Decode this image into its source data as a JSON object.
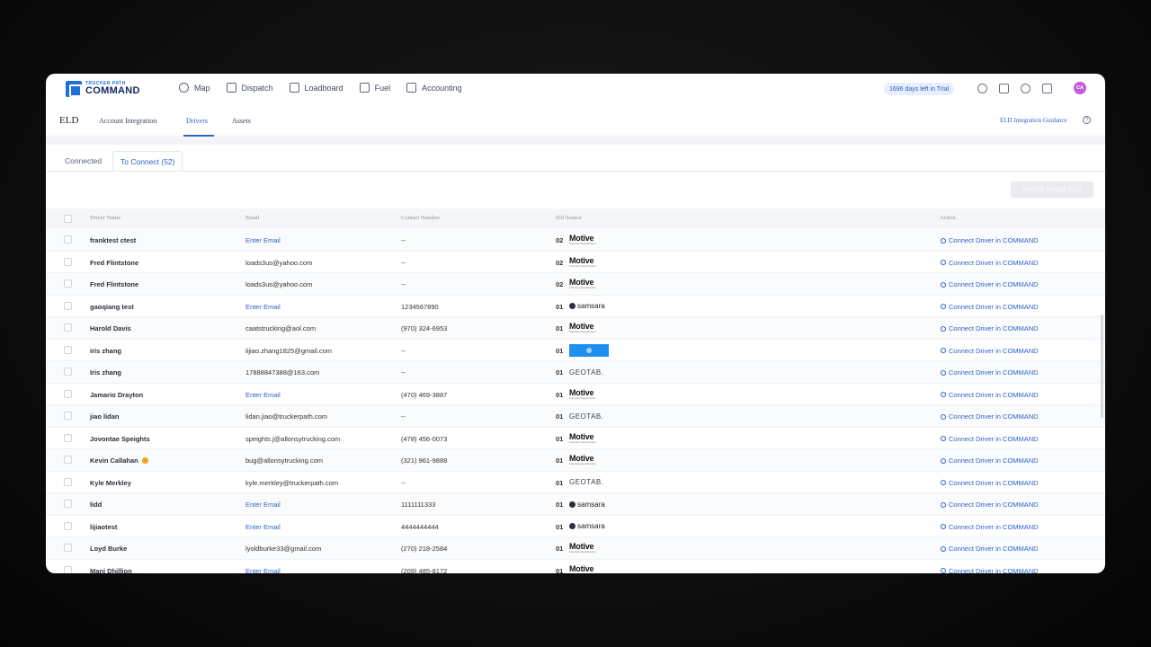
{
  "brand": {
    "small": "TRUCKER PATH",
    "name": "COMMAND"
  },
  "nav": [
    {
      "label": "Map",
      "icon": "globe-icon"
    },
    {
      "label": "Dispatch",
      "icon": "calendar-icon"
    },
    {
      "label": "Loadboard",
      "icon": "box-icon"
    },
    {
      "label": "Fuel",
      "icon": "fuel-icon"
    },
    {
      "label": "Accounting",
      "icon": "wallet-icon"
    }
  ],
  "trial": "1696 days left in Trial",
  "avatar": "CA",
  "subnav": {
    "title": "ELD",
    "tabs": [
      "Account Integration",
      "Drivers",
      "Assets"
    ],
    "active": "Drivers",
    "guidance": "ELD Integration Guidance"
  },
  "connect_tabs": [
    "Connected",
    "To Connect (52)"
  ],
  "invite_button": "INVITE FROM ELD",
  "columns": {
    "name": "Driver Name",
    "email": "Email",
    "phone": "Contact Number",
    "source": "Eld Source",
    "action": "Action"
  },
  "action_label": "Connect Driver in COMMAND",
  "rows": [
    {
      "name": "franktest ctest",
      "email": "Enter Email",
      "email_link": true,
      "phone": "--",
      "num": "02",
      "source": "motive"
    },
    {
      "name": "Fred Flintstone",
      "email": "loads3us@yahoo.com",
      "email_link": false,
      "phone": "--",
      "num": "02",
      "source": "motive"
    },
    {
      "name": "Fred Flintstone",
      "email": "loads3us@yahoo.com",
      "email_link": false,
      "phone": "--",
      "num": "02",
      "source": "motive"
    },
    {
      "name": "gaoqiang test",
      "email": "Enter Email",
      "email_link": true,
      "phone": "1234567890",
      "num": "01",
      "source": "samsara"
    },
    {
      "name": "Harold Davis",
      "email": "caatstrucking@aol.com",
      "email_link": false,
      "phone": "(970) 324-6953",
      "num": "01",
      "source": "motive"
    },
    {
      "name": "iris zhang",
      "email": "lijiao.zhang1825@gmail.com",
      "email_link": false,
      "phone": "--",
      "num": "01",
      "source": "blue"
    },
    {
      "name": "Iris zhang",
      "email": "17888847388@163.com",
      "email_link": false,
      "phone": "--",
      "num": "01",
      "source": "geotab"
    },
    {
      "name": "Jamario Drayton",
      "email": "Enter Email",
      "email_link": true,
      "phone": "(470) 469-3887",
      "num": "01",
      "source": "motive"
    },
    {
      "name": "jiao lidan",
      "email": "lidan.jiao@truckerpath.com",
      "email_link": false,
      "phone": "--",
      "num": "01",
      "source": "geotab"
    },
    {
      "name": "Jovontae Speights",
      "email": "speights.j@allonsytrucking.com",
      "email_link": false,
      "phone": "(478) 456-0073",
      "num": "01",
      "source": "motive"
    },
    {
      "name": "Kevin Callahan",
      "email": "bug@allonsytrucking.com",
      "email_link": false,
      "phone": "(321) 961-9888",
      "num": "01",
      "source": "motive",
      "warn": true
    },
    {
      "name": "Kyle Merkley",
      "email": "kyle.merkley@truckerpath.com",
      "email_link": false,
      "phone": "--",
      "num": "01",
      "source": "geotab"
    },
    {
      "name": "lidd",
      "email": "Enter Email",
      "email_link": true,
      "phone": "1111111333",
      "num": "01",
      "source": "samsara"
    },
    {
      "name": "lijiaotest",
      "email": "Enter Email",
      "email_link": true,
      "phone": "4444444444",
      "num": "01",
      "source": "samsara"
    },
    {
      "name": "Loyd Burke",
      "email": "lyoldburke33@gmail.com",
      "email_link": false,
      "phone": "(270) 218-2584",
      "num": "01",
      "source": "motive"
    },
    {
      "name": "Mani Dhillion",
      "email": "Enter Email",
      "email_link": true,
      "phone": "(209) 485-8172",
      "num": "01",
      "source": "motive"
    }
  ],
  "logos": {
    "motive": "Motive",
    "motive_sub": "Formerly KeepTruckin",
    "samsara": "samsara",
    "geotab": "GEOTAB."
  }
}
